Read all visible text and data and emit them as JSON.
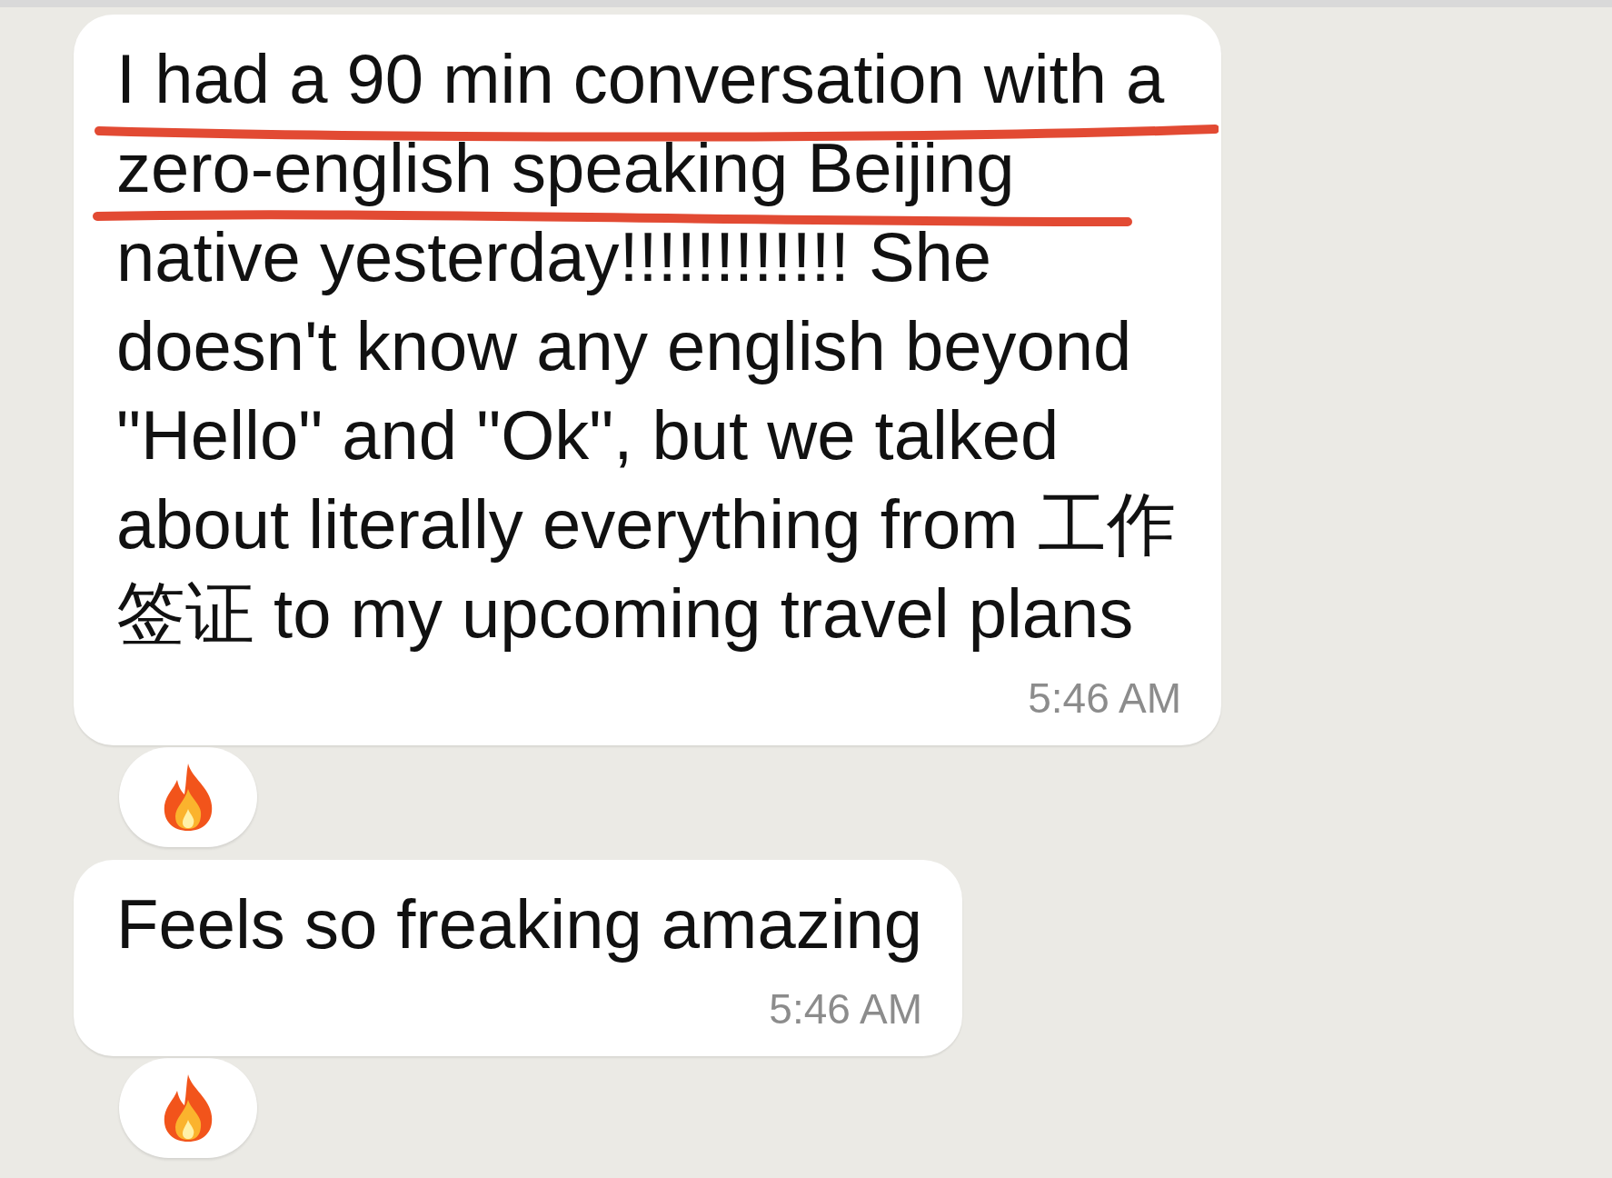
{
  "messages": [
    {
      "text": "I had a 90 min conversation with a\nzero-english speaking Beijing\nnative yesterday!!!!!!!!!!!! She\ndoesn't know any english beyond\n\"Hello\" and \"Ok\", but we talked\nabout literally everything from 工作签证 to my upcoming travel plans",
      "time": "5:46 AM",
      "underlined": true
    },
    {
      "text": "Feels so freaking amazing",
      "time": "5:46 AM",
      "underlined": false
    }
  ]
}
